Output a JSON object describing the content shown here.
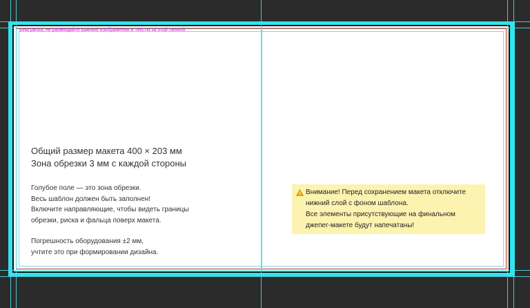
{
  "canvas": {
    "colors": {
      "background": "#2b2b2b",
      "bleed": "#2ee6ee",
      "guide": "#4fd8e6",
      "trim": "#c0392b",
      "risk_text": "#e020d0",
      "warning_bg": "#fdf3b0"
    }
  },
  "template": {
    "risk_note": "зона риска, не размещайте важные изображения и тексты за этой линией",
    "title_lines": [
      "Общий размер макета 400 × 203 мм",
      "Зона обрезки 3 мм  с каждой стороны"
    ],
    "body_lines": [
      "Голубое поле — это зона обрезки.",
      "Весь шаблон должен быть заполнен!",
      "Включите направляющие, чтобы видеть границы",
      "обрезки, риска и фальца поверх макета."
    ],
    "tolerance_lines": [
      "Погрешность оборудования ±2 мм,",
      "учтите это при формировании дизайна."
    ],
    "warning": {
      "icon": "warning-triangle-icon",
      "lines": [
        "Внимание! Перед сохранением макета отключите",
        "нижний слой с фоном шаблона.",
        "Все элементы присутствующие на финальном",
        "джепег-макете будут напечатаны!"
      ]
    }
  }
}
